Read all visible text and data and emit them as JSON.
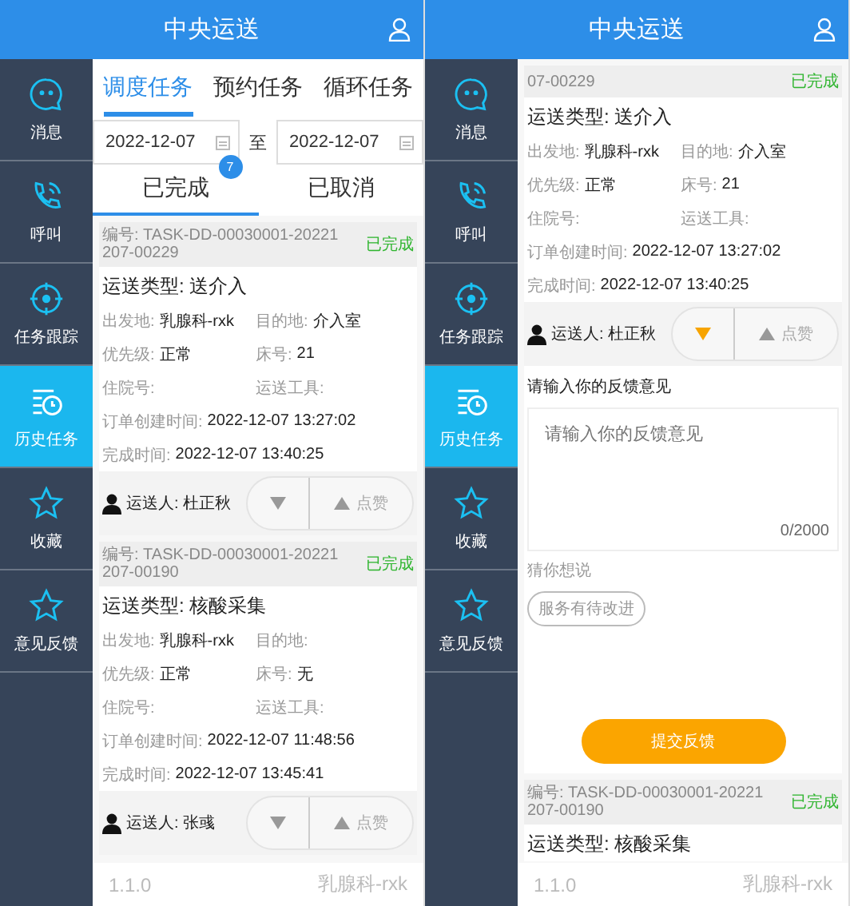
{
  "screens": [
    {
      "header": {
        "title": "中央运送"
      },
      "sidebar": [
        {
          "label": "消息",
          "selected": false
        },
        {
          "label": "呼叫",
          "selected": false
        },
        {
          "label": "任务跟踪",
          "selected": false
        },
        {
          "label": "历史任务",
          "selected": true
        },
        {
          "label": "收藏",
          "selected": false
        },
        {
          "label": "意见反馈",
          "selected": false
        }
      ],
      "task_tabs": [
        {
          "label": "调度任务",
          "selected": true
        },
        {
          "label": "预约任务",
          "selected": false
        },
        {
          "label": "循环任务",
          "selected": false
        }
      ],
      "date_range": {
        "start": "2022-12-07",
        "separator": "至",
        "end": "2022-12-07"
      },
      "status_tabs": [
        {
          "label": "已完成",
          "selected": true,
          "badge": "7"
        },
        {
          "label": "已取消",
          "selected": false
        }
      ],
      "cards": [
        {
          "number": "编号: TASK-DD-00030001-20221207-00229",
          "status": "已完成",
          "type": "运送类型: 送介入",
          "details": [
            [
              {
                "label": "出发地:",
                "value": "乳腺科-rxk"
              },
              {
                "label": "目的地:",
                "value": "介入室"
              }
            ],
            [
              {
                "label": "优先级:",
                "value": "正常"
              },
              {
                "label": "床号:",
                "value": "21"
              }
            ],
            [
              {
                "label": "住院号:"
              },
              {
                "label": "运送工具:"
              }
            ],
            [
              {
                "label": "订单创建时间:",
                "value": "2022-12-07 13:27:02"
              }
            ],
            [
              {
                "label": "完成时间:",
                "value": "2022-12-07 13:40:25"
              }
            ]
          ],
          "carrier": "运送人: 杜正秋",
          "down_selected": false,
          "like": "点赞"
        },
        {
          "number": "编号: TASK-DD-00030001-20221207-00190",
          "status": "已完成",
          "type": "运送类型: 核酸采集",
          "details": [
            [
              {
                "label": "出发地:",
                "value": "乳腺科-rxk"
              },
              {
                "label": "目的地:"
              }
            ],
            [
              {
                "label": "优先级:",
                "value": "正常"
              },
              {
                "label": "床号:",
                "value": "无"
              }
            ],
            [
              {
                "label": "住院号:"
              },
              {
                "label": "运送工具:"
              }
            ],
            [
              {
                "label": "订单创建时间:",
                "value": "2022-12-07 11:48:56"
              }
            ],
            [
              {
                "label": "完成时间:",
                "value": "2022-12-07 13:45:41"
              }
            ]
          ],
          "carrier": "运送人: 张彧",
          "down_selected": false,
          "like": "点赞"
        }
      ],
      "footer": {
        "version": "1.1.0",
        "department": "乳腺科-rxk"
      }
    },
    {
      "header": {
        "title": "中央运送"
      },
      "sidebar": [
        {
          "label": "消息",
          "selected": false
        },
        {
          "label": "呼叫",
          "selected": false
        },
        {
          "label": "任务跟踪",
          "selected": false
        },
        {
          "label": "历史任务",
          "selected": true
        },
        {
          "label": "收藏",
          "selected": false
        },
        {
          "label": "意见反馈",
          "selected": false
        }
      ],
      "cards": [
        {
          "number": "07-00229",
          "status": "已完成",
          "type": "运送类型: 送介入",
          "details": [
            [
              {
                "label": "出发地:",
                "value": "乳腺科-rxk"
              },
              {
                "label": "目的地:",
                "value": "介入室"
              }
            ],
            [
              {
                "label": "优先级:",
                "value": "正常"
              },
              {
                "label": "床号:",
                "value": "21"
              }
            ],
            [
              {
                "label": "住院号:"
              },
              {
                "label": "运送工具:"
              }
            ],
            [
              {
                "label": "订单创建时间:",
                "value": "2022-12-07 13:27:02"
              }
            ],
            [
              {
                "label": "完成时间:",
                "value": "2022-12-07 13:40:25"
              }
            ]
          ],
          "carrier": "运送人: 杜正秋",
          "down_selected": true,
          "like": "点赞",
          "feedback": {
            "prompt": "请输入你的反馈意见",
            "placeholder": "请输入你的反馈意见",
            "counter": "0/2000",
            "suggest_label": "猜你想说",
            "suggestions": [
              "服务有待改进"
            ],
            "submit": "提交反馈"
          }
        },
        {
          "number": "编号: TASK-DD-00030001-20221207-00190",
          "status": "已完成",
          "type": "运送类型: 核酸采集"
        }
      ],
      "footer": {
        "version": "1.1.0",
        "department": "乳腺科-rxk"
      }
    }
  ]
}
